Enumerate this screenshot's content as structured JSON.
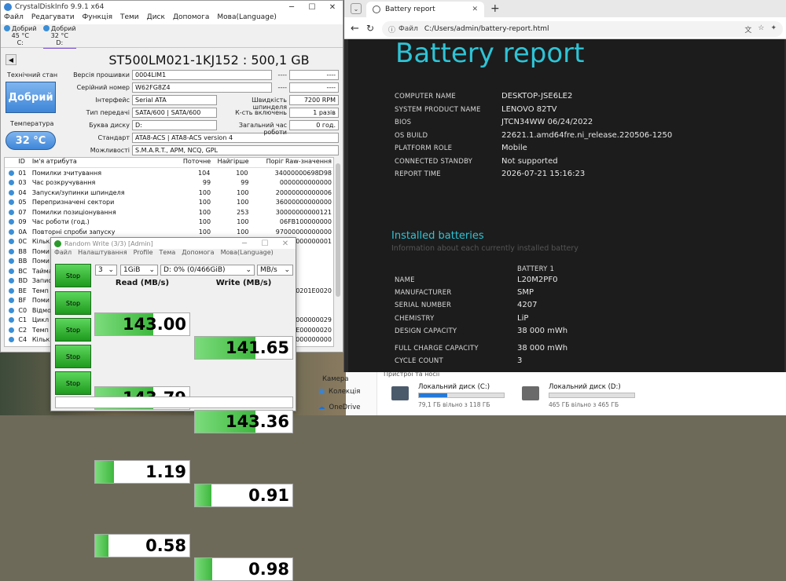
{
  "cdi": {
    "title": "CrystalDiskInfo 9.9.1 x64",
    "menu": [
      "Файл",
      "Редагувати",
      "Функція",
      "Теми",
      "Диск",
      "Допомога",
      "Мова(Language)"
    ],
    "disks": [
      {
        "status": "Добрий",
        "temp": "45 °C",
        "letter": "C:"
      },
      {
        "status": "Добрий",
        "temp": "32 °C",
        "letter": "D:"
      }
    ],
    "model": "ST500LM021-1KJ152 : 500,1 GB",
    "health_label": "Технічний стан",
    "health_value": "Добрий",
    "temp_label": "Температура",
    "temp_value": "32 °C",
    "fields": {
      "firmware_label": "Версія прошивки",
      "firmware": "0004LIM1",
      "serial_label": "Серійний номер",
      "serial": "W62FG8Z4",
      "interface_label": "Інтерфейс",
      "interface": "Serial ATA",
      "transfer_label": "Тип передачі",
      "transfer": "SATA/600 | SATA/600",
      "letter_label": "Буква диску",
      "letter": "D:",
      "standard_label": "Стандарт",
      "standard": "ATA8-ACS | ATA8-ACS version 4",
      "features_label": "Можливості",
      "features": "S.M.A.R.T., APM, NCQ, GPL",
      "blank1": "----",
      "blank1b": "----",
      "blank2": "----",
      "blank2b": "----",
      "rpm_label": "Швидкість шпинделя",
      "rpm": "7200 RPM",
      "power_on_count_label": "К-сть включень",
      "power_on_count": "1 разів",
      "power_on_hours_label": "Загальний час роботи",
      "power_on_hours": "0 год."
    },
    "smart_headers": [
      "ID",
      "Ім'я атрибута",
      "Поточне",
      "Найгірше",
      "Поріг",
      "Raw-значення"
    ],
    "smart_rows": [
      [
        "01",
        "Помилки зчитування",
        "104",
        "100",
        "34",
        "000000698D98"
      ],
      [
        "03",
        "Час розкручування",
        "99",
        "99",
        "0",
        "000000000000"
      ],
      [
        "04",
        "Запуски/зупинки шпинделя",
        "100",
        "100",
        "20",
        "000000000006"
      ],
      [
        "05",
        "Перепризначені сектори",
        "100",
        "100",
        "36",
        "000000000000"
      ],
      [
        "07",
        "Помилки позиціонування",
        "100",
        "253",
        "30",
        "000000000121"
      ],
      [
        "09",
        "Час роботи (год.)",
        "100",
        "100",
        "0",
        "6FB100000000"
      ],
      [
        "0A",
        "Повторні спроби запуску",
        "100",
        "100",
        "97",
        "000000000000"
      ],
      [
        "0C",
        "Кількі",
        "",
        "",
        "",
        "000000000001"
      ],
      [
        "B8",
        "Поми",
        "",
        "",
        "",
        ""
      ],
      [
        "BB",
        "Поми",
        "",
        "",
        "",
        ""
      ],
      [
        "BC",
        "Тайма",
        "",
        "",
        "",
        ""
      ],
      [
        "BD",
        "Запис",
        "",
        "",
        "",
        ""
      ],
      [
        "BE",
        "Темп",
        "",
        "",
        "",
        "00201E0020"
      ],
      [
        "BF",
        "Поми",
        "",
        "",
        "",
        ""
      ],
      [
        "C0",
        "Відмо",
        "",
        "",
        "",
        ""
      ],
      [
        "C1",
        "Цикл",
        "",
        "",
        "",
        "000000029"
      ],
      [
        "C2",
        "Темп",
        "",
        "",
        "",
        "1E00000020"
      ],
      [
        "C4",
        "Кількі",
        "",
        "",
        "",
        "000000000"
      ]
    ]
  },
  "rw": {
    "title": "Random Write (3/3) [Admin]",
    "menu": [
      "Файл",
      "Налаштування",
      "Profile",
      "Тема",
      "Допомога",
      "Мова(Language)"
    ],
    "count": "3",
    "size": "1GiB",
    "drive": "D: 0% (0/466GiB)",
    "unit": "MB/s",
    "stop_label": "Stop",
    "read_header": "Read (MB/s)",
    "write_header": "Write (MB/s)",
    "rows": [
      {
        "read": "143.00",
        "write": "141.65",
        "read_fill": 0.62,
        "write_fill": 0.62
      },
      {
        "read": "143.79",
        "write": "143.36",
        "read_fill": 0.62,
        "write_fill": 0.62
      },
      {
        "read": "1.19",
        "write": "0.91",
        "read_fill": 0.2,
        "write_fill": 0.17
      },
      {
        "read": "0.58",
        "write": "0.98",
        "read_fill": 0.14,
        "write_fill": 0.18
      }
    ]
  },
  "browser": {
    "tab_title": "Battery report",
    "url_prefix": "Файл",
    "url": "C:/Users/admin/battery-report.html",
    "heading": "Battery report",
    "system": [
      {
        "key": "COMPUTER NAME",
        "value": "DESKTOP-JSE6LE2"
      },
      {
        "key": "SYSTEM PRODUCT NAME",
        "value": "LENOVO 82TV"
      },
      {
        "key": "BIOS",
        "value": "JTCN34WW 06/24/2022"
      },
      {
        "key": "OS BUILD",
        "value": "22621.1.amd64fre.ni_release.220506-1250"
      },
      {
        "key": "PLATFORM ROLE",
        "value": "Mobile"
      },
      {
        "key": "CONNECTED STANDBY",
        "value": "Not supported"
      },
      {
        "key": "REPORT TIME",
        "value": "2026-07-21   15:16:23"
      }
    ],
    "installed_heading": "Installed batteries",
    "installed_sub": "Information about each currently installed battery",
    "battery_header": "BATTERY 1",
    "battery": [
      {
        "key": "NAME",
        "value": "L20M2PF0"
      },
      {
        "key": "MANUFACTURER",
        "value": "SMP"
      },
      {
        "key": "SERIAL NUMBER",
        "value": "4207"
      },
      {
        "key": "CHEMISTRY",
        "value": "LiP"
      },
      {
        "key": "DESIGN CAPACITY",
        "value": "38 000 mWh"
      },
      {
        "key": "FULL CHARGE CAPACITY",
        "value": "38 000 mWh"
      },
      {
        "key": "CYCLE COUNT",
        "value": "3"
      }
    ]
  },
  "explorer": {
    "sidebar": [
      "Камера",
      "Колекція",
      "OneDrive"
    ],
    "section": "Пристрої та носії",
    "drives": [
      {
        "name": "Локальний диск (C:)",
        "free": "79,1 ГБ вільно з 118 ГБ",
        "fill": 0.33
      },
      {
        "name": "Локальний диск (D:)",
        "free": "465 ГБ вільно з 465 ГБ",
        "fill": 0.0
      }
    ]
  },
  "colors": {
    "accent": "#2ec4d6",
    "cdi_blue": "#3e86d8",
    "cdm_green": "#3eb83e"
  }
}
